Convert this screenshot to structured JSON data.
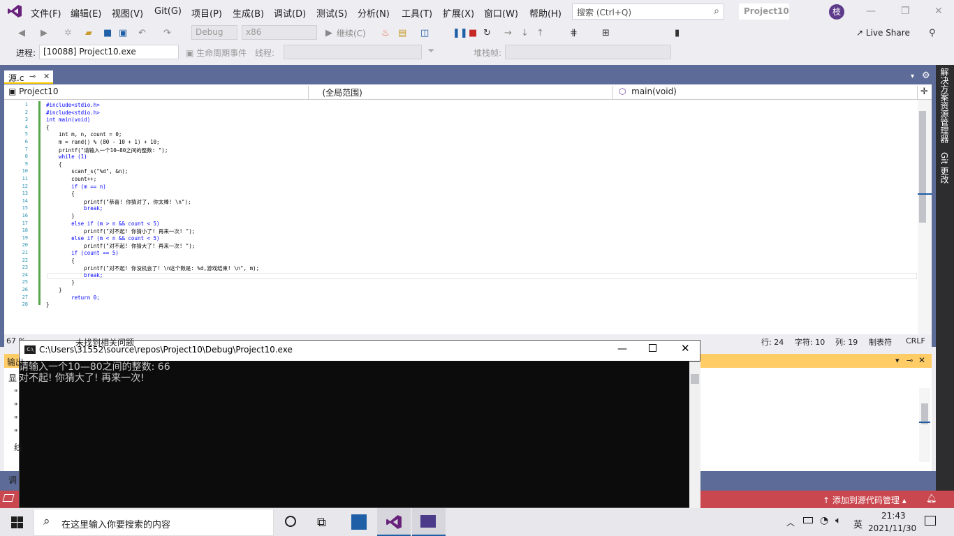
{
  "menu": [
    "文件(F)",
    "编辑(E)",
    "视图(V)",
    "Git(G)",
    "项目(P)",
    "生成(B)",
    "调试(D)",
    "测试(S)",
    "分析(N)",
    "工具(T)",
    "扩展(X)",
    "窗口(W)",
    "帮助(H)"
  ],
  "search_placeholder": "搜索 (Ctrl+Q)",
  "project_name": "Project10",
  "avatar_letter": "枝",
  "toolbar": {
    "config": "Debug",
    "platform": "x86",
    "continue": "继续(C)",
    "live_share": "Live Share"
  },
  "toolbar2": {
    "process_label": "进程:",
    "process_value": "[10088] Project10.exe",
    "lifecycle": "生命周期事件",
    "thread_label": "线程:",
    "stackframe_label": "堆栈帧:"
  },
  "tab": {
    "name": "源.c",
    "pin": "⊸",
    "close": "✕"
  },
  "navbar": {
    "project": "Project10",
    "scope": "(全局范围)",
    "function": "main(void)"
  },
  "code_lines": [
    "#include<stdio.h>",
    "#include<stdio.h>",
    "int main(void)",
    "{",
    "    int m, n, count = 0;",
    "    m = rand() % (80 - 10 + 1) + 10;",
    "    printf(\"请输入一个10—80之间的整数: \");",
    "    while (1)",
    "    {",
    "        scanf_s(\"%d\", &n);",
    "        count++;",
    "        if (m == n)",
    "        {",
    "            printf(\"恭喜! 你猜对了, 你太棒! \\n\");",
    "            break;",
    "        }",
    "        else if (m > n && count < 5)",
    "            printf(\"对不起! 你猜小了! 再来一次! \");",
    "        else if (m < n && count < 5)",
    "            printf(\"对不起! 你猜大了! 再来一次! \");",
    "        if (count == 5)",
    "        {",
    "            printf(\"对不起! 你没机会了! \\n这个数是: %d,游戏结束! \\n\", m);",
    "            break;",
    "        }",
    "    }",
    "        return 0;",
    "}"
  ],
  "status": {
    "zoom": "67 %",
    "issues": "未找到相关问题",
    "row": "行: 24",
    "char": "字符: 10",
    "col": "列: 19",
    "tab": "制表符",
    "eol": "CRLF"
  },
  "side_tabs": [
    "解决方案资源管理器",
    "Git 更改"
  ],
  "output": {
    "header": "输出",
    "show_label": "显",
    "lines": [
      "\"",
      "\"",
      "\"",
      "\"",
      "线"
    ],
    "bottom_tab": "调"
  },
  "console": {
    "title": "C:\\Users\\31552\\source\\repos\\Project10\\Debug\\Project10.exe",
    "icon": "C:\\",
    "lines": [
      "请输入一个10—80之间的整数: 66",
      "对不起! 你猜大了! 再来一次!"
    ]
  },
  "statusbar": {
    "source_control": "添加到源代码管理",
    "notifications": "1"
  },
  "taskbar": {
    "search_placeholder": "在这里输入你要搜索的内容",
    "time": "21:43",
    "date": "2021/11/30",
    "ime": "英"
  }
}
